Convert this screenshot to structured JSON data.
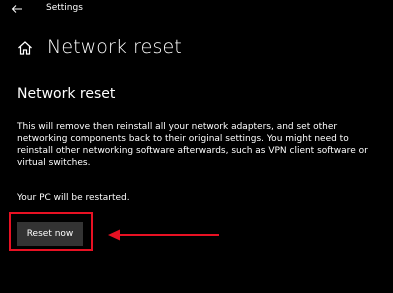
{
  "window": {
    "title": "Settings"
  },
  "icons": {
    "back": "back-arrow-icon",
    "home": "home-icon"
  },
  "page": {
    "title": "Network reset"
  },
  "section": {
    "heading": "Network reset",
    "description": "This will remove then reinstall all your network adapters, and set other networking components back to their original settings. You might need to reinstall other networking software afterwards, such as VPN client software or virtual switches.",
    "restart_note": "Your PC will be restarted."
  },
  "actions": {
    "reset_label": "Reset now"
  },
  "colors": {
    "background": "#000000",
    "text": "#ffffff",
    "button": "#333333",
    "annotation": "#e81123"
  }
}
